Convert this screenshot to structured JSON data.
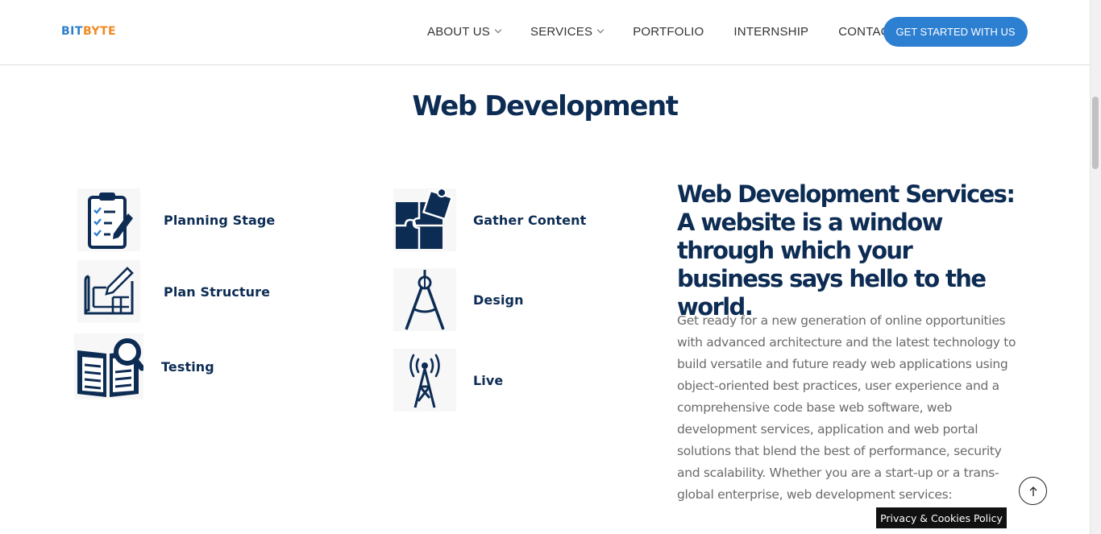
{
  "header": {
    "logo": {
      "part1": "BIT",
      "part2": "BYTE"
    },
    "nav": [
      {
        "label": "ABOUT US",
        "dropdown": true
      },
      {
        "label": "SERVICES",
        "dropdown": true
      },
      {
        "label": "PORTFOLIO",
        "dropdown": false
      },
      {
        "label": "INTERNSHIP",
        "dropdown": false
      },
      {
        "label": "CONTACT",
        "dropdown": false
      }
    ],
    "cta_label": "GET STARTED WITH US"
  },
  "section": {
    "title": "Web Development"
  },
  "steps": [
    {
      "label": "Planning Stage",
      "icon": "clipboard-checklist-icon"
    },
    {
      "label": "Plan Structure",
      "icon": "blueprint-icon"
    },
    {
      "label": "Testing",
      "icon": "book-magnifier-icon"
    },
    {
      "label": "Gather Content",
      "icon": "puzzle-icon"
    },
    {
      "label": "Design",
      "icon": "compass-icon"
    },
    {
      "label": "Live",
      "icon": "antenna-tower-icon"
    }
  ],
  "services": {
    "heading": "Web Development Services: A website is a window through which your business says hello to the world.",
    "body": "Get ready for a new generation of online opportunities with advanced architecture and the latest technology to build versatile and future ready web applications using object-oriented best practices, user experience and a comprehensive code base web software, web development services, application and web portal solutions that blend the best of performance, security and scalability. Whether you are a start-up or a trans-global enterprise, web development services:"
  },
  "footer": {
    "privacy_label": "Privacy & Cookies Policy",
    "back_to_top_icon": "arrow-up-icon"
  },
  "colors": {
    "navy": "#0d2c54",
    "accent_blue": "#2c7fd1",
    "logo_orange": "#f08a24",
    "body_gray": "#6b6b6b"
  }
}
